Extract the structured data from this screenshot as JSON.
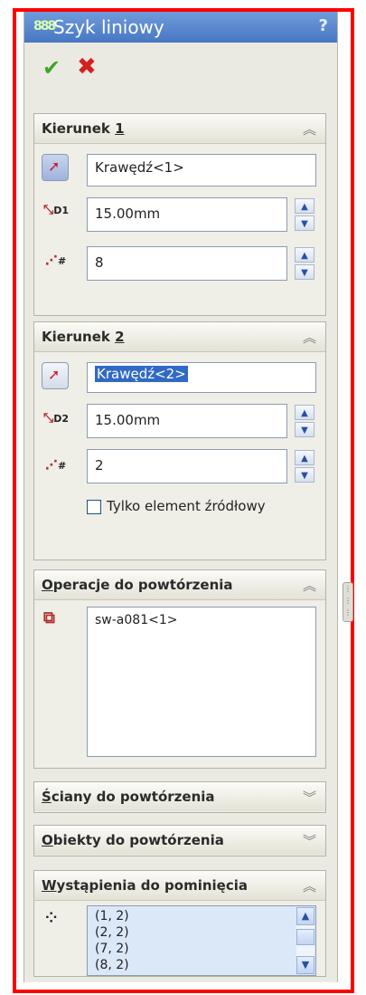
{
  "title": "Szyk liniowy",
  "help": "?",
  "ok_symbol": "✔",
  "cancel_symbol": "✖",
  "dir1": {
    "heading_prefix": "Kierunek ",
    "heading_key": "1",
    "edge": "Krawędź<1>",
    "spacing": "15.00mm",
    "count": "8",
    "dim_label": "D1"
  },
  "dir2": {
    "heading_prefix": "Kierunek ",
    "heading_key": "2",
    "edge": "Krawędź<2>",
    "spacing": "15.00mm",
    "count": "2",
    "dim_label": "D2",
    "seed_only_label": "Tylko element źródłowy",
    "seed_only_checked": false
  },
  "features": {
    "heading_key": "O",
    "heading_rest": "peracje do powtórzenia",
    "items": [
      "sw-a081<1>"
    ]
  },
  "faces": {
    "heading_key": "Ś",
    "heading_rest": "ciany do powtórzenia"
  },
  "bodies": {
    "heading_key": "O",
    "heading_rest": "biekty do powtórzenia"
  },
  "skip": {
    "heading_key": "W",
    "heading_rest": "ystąpienia do pominięcia",
    "items": [
      "(1, 2)",
      "(2, 2)",
      "(7, 2)",
      "(8, 2)"
    ]
  },
  "icons": {
    "app": "linear-pattern-icon",
    "chevron_expanded": "double-chevron-up-icon",
    "chevron_collapsed": "double-chevron-down-icon"
  },
  "colors": {
    "title_bar": "#5a86cc",
    "frame": "#ff0000",
    "selection": "#316ac5",
    "ok": "#3fa52a",
    "cancel": "#d42020"
  }
}
